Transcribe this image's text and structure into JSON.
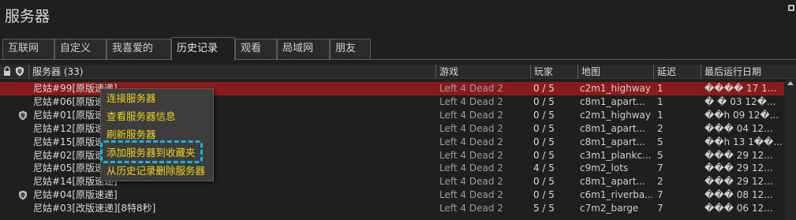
{
  "window": {
    "title": "服务器"
  },
  "tabs": [
    {
      "label": "互联网"
    },
    {
      "label": "自定义"
    },
    {
      "label": "我喜爱的"
    },
    {
      "label": "历史记录",
      "active": true
    },
    {
      "label": "观看"
    },
    {
      "label": "局域网"
    },
    {
      "label": "朋友"
    }
  ],
  "columns": {
    "server": "服务器 (33)",
    "game": "游戏",
    "players": "玩家",
    "map": "地图",
    "ping": "延迟",
    "last_played": "最后运行日期"
  },
  "rows": [
    {
      "name": "尼姑#99[原版速递]",
      "game": "Left 4 Dead 2",
      "players": "0 / 5",
      "map": "c2m1_highway",
      "ping": "1",
      "date": "���� 17 1...",
      "shield": false,
      "selected": true
    },
    {
      "name": "尼姑#06[原版速递]",
      "game": "Left 4 Dead 2",
      "players": "0 / 5",
      "map": "c8m1_apart...",
      "ping": "1",
      "date": "� � 03 12�...",
      "shield": false
    },
    {
      "name": "尼姑#01[原版速递]",
      "game": "Left 4 Dead 2",
      "players": "0 / 5",
      "map": "c2m1_highway",
      "ping": "1",
      "date": "��h 09 12�...",
      "shield": true
    },
    {
      "name": "尼姑#12[原版速递]",
      "game": "Left 4 Dead 2",
      "players": "0 / 5",
      "map": "c8m1_apart...",
      "ping": "2",
      "date": "��� 04 12...",
      "shield": false
    },
    {
      "name": "尼姑#15[原版速递]",
      "game": "Left 4 Dead 2",
      "players": "0 / 5",
      "map": "c8m1_apart...",
      "ping": "5",
      "date": "��h 13 1��...",
      "shield": false
    },
    {
      "name": "尼姑#02[原版速递]",
      "game": "Left 4 Dead 2",
      "players": "0 / 5",
      "map": "c3m1_plankc...",
      "ping": "5",
      "date": "��� 29 12...",
      "shield": false
    },
    {
      "name": "尼姑#05[原版速递]",
      "game": "Left 4 Dead 2",
      "players": "4 / 5",
      "map": "c9m2_lots",
      "ping": "7",
      "date": "��� 29 12...",
      "shield": false
    },
    {
      "name": "尼姑#14[原版速递]",
      "game": "Left 4 Dead 2",
      "players": "0 / 5",
      "map": "c8m1_apart...",
      "ping": "2",
      "date": "��� 29 12...",
      "shield": false
    },
    {
      "name": "尼姑#04[原版速递]",
      "game": "Left 4 Dead 2",
      "players": "0 / 5",
      "map": "c6m1_riverba...",
      "ping": "7",
      "date": "��� 08 12...",
      "shield": true
    },
    {
      "name": "尼姑#03[改版速递][8特8秒]",
      "game": "Left 4 Dead 2",
      "players": "5 / 5",
      "map": "c7m2_barge",
      "ping": "7",
      "date": "��� 06 12...",
      "shield": false
    }
  ],
  "context_menu": {
    "items": [
      {
        "label": "连接服务器"
      },
      {
        "label": "查看服务器信息"
      },
      {
        "label": "刷新服务器"
      },
      {
        "label": "添加服务器到收藏夹"
      },
      {
        "label": "从历史记录删除服务器"
      }
    ]
  },
  "colors": {
    "background": "#1f1f1f",
    "selected_row": "#8a1b1b",
    "menu_text": "#f0d21a",
    "highlight_border": "#18b4e6"
  },
  "icons": {
    "lock": "lock-icon",
    "shield": "shield-icon"
  }
}
